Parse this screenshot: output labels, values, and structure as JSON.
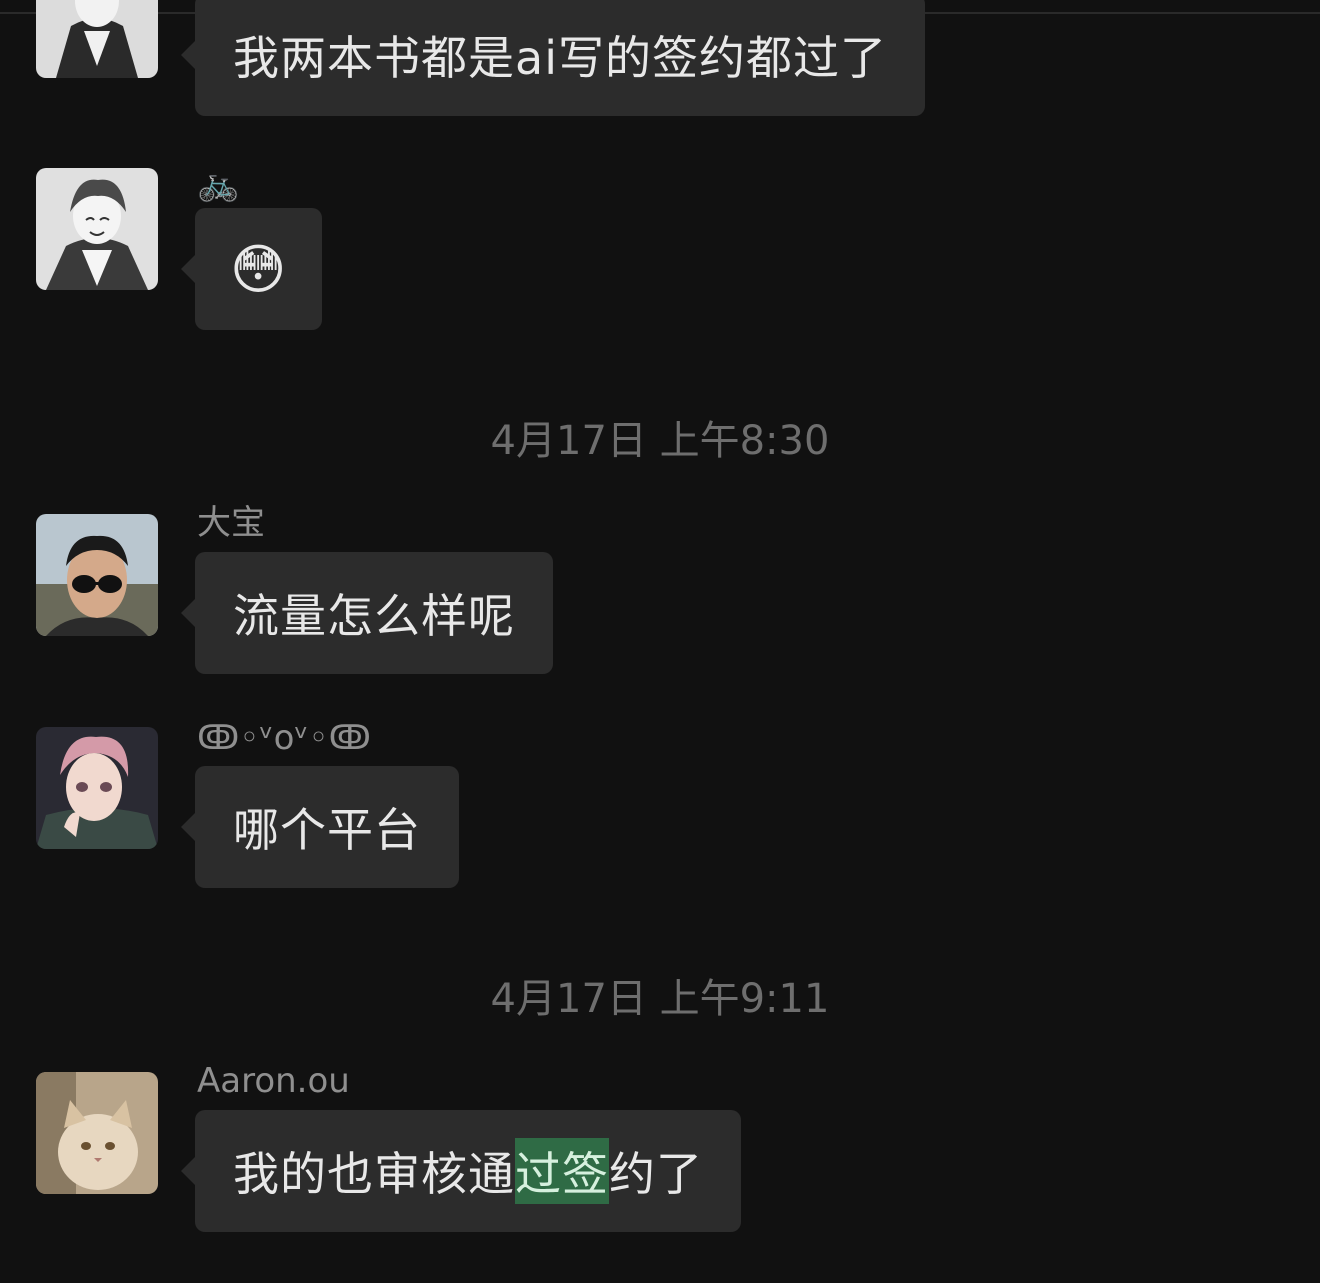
{
  "messages": [
    {
      "name": "",
      "text": "我两本书都是ai写的签约都过了"
    },
    {
      "name": "🚲",
      "text": "😳"
    },
    {
      "name": "大宝",
      "text": "流量怎么样呢"
    },
    {
      "name": "ↂ◦ᵛоᵛ◦ↂ",
      "text": "哪个平台"
    },
    {
      "name": "Aaron.ou",
      "text_before": "我的也审核通",
      "text_highlight": "过签",
      "text_after": "约了"
    }
  ],
  "timestamps": [
    "4月17日 上午8:30",
    "4月17日 上午9:11"
  ],
  "colors": {
    "background": "#111111",
    "bubble": "#2c2c2c",
    "highlight": "#2f6b45"
  }
}
